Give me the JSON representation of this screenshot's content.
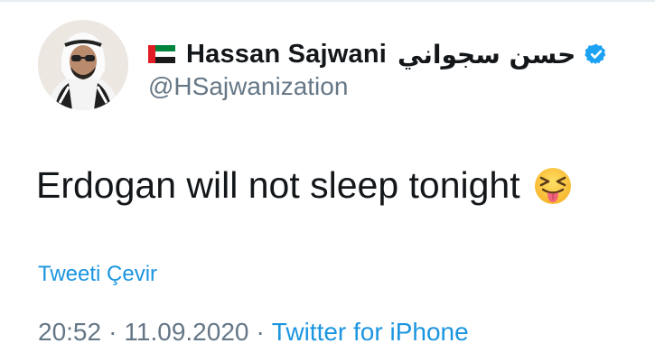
{
  "tweet": {
    "author": {
      "flag_icon": "uae-flag-icon",
      "display_name": "Hassan Sajwani",
      "arabic_name": "حسن سجواني",
      "verified_icon": "verified-badge-icon",
      "handle": "@HSajwanization"
    },
    "text": "Erdogan will not sleep tonight",
    "emoji_icon": "squinting-face-with-tongue-emoji",
    "translate_link": "Tweeti Çevir",
    "time": "20:52",
    "date": "11.09.2020",
    "separator": "·",
    "source": "Twitter for iPhone"
  },
  "colors": {
    "text": "#14171a",
    "secondary": "#657786",
    "link": "#1b95e0",
    "verified": "#1da1f2"
  }
}
